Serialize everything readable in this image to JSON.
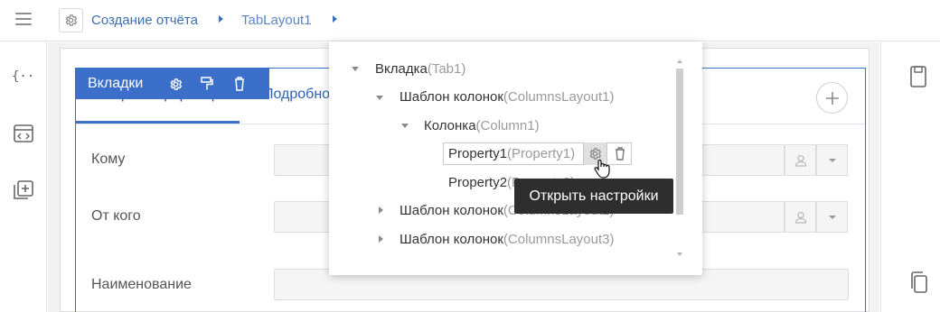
{
  "breadcrumb": {
    "items": [
      "Создание отчёта",
      "TabLayout1"
    ]
  },
  "selection": {
    "title": "Вкладки"
  },
  "tabs": {
    "active": "Общая информация",
    "other": "Подробно"
  },
  "fields": [
    {
      "label": "Кому"
    },
    {
      "label": "От кого"
    },
    {
      "label": "Наименование"
    }
  ],
  "tree": {
    "rows": [
      {
        "name": "Вкладка",
        "id": "(Tab1)"
      },
      {
        "name": "Шаблон колонок",
        "id": "(ColumnsLayout1)"
      },
      {
        "name": "Колонка",
        "id": "(Column1)"
      },
      {
        "name": "Property1",
        "id": "(Property1)"
      },
      {
        "name": "Property2",
        "id": "(Property2)"
      },
      {
        "name": "Шаблон колонок",
        "id": "(ColumnsLayout2)"
      },
      {
        "name": "Шаблон колонок",
        "id": "(ColumnsLayout3)"
      }
    ]
  },
  "tooltip": {
    "text": "Открыть настройки"
  },
  "icons": {
    "menu": "hamburger-icon",
    "settings": "gear-icon",
    "braces": "code-braces-icon",
    "html": "code-window-icon",
    "add": "add-box-icon",
    "page": "page-icon",
    "copy": "copy-icon",
    "trash": "trash-icon",
    "format": "format-paint-icon",
    "user": "user-icon",
    "caret": "caret-down-icon"
  },
  "colors": {
    "accent": "#3b6fc9",
    "link": "#3d6fb4",
    "tooltip_bg": "#2e2e2e"
  }
}
